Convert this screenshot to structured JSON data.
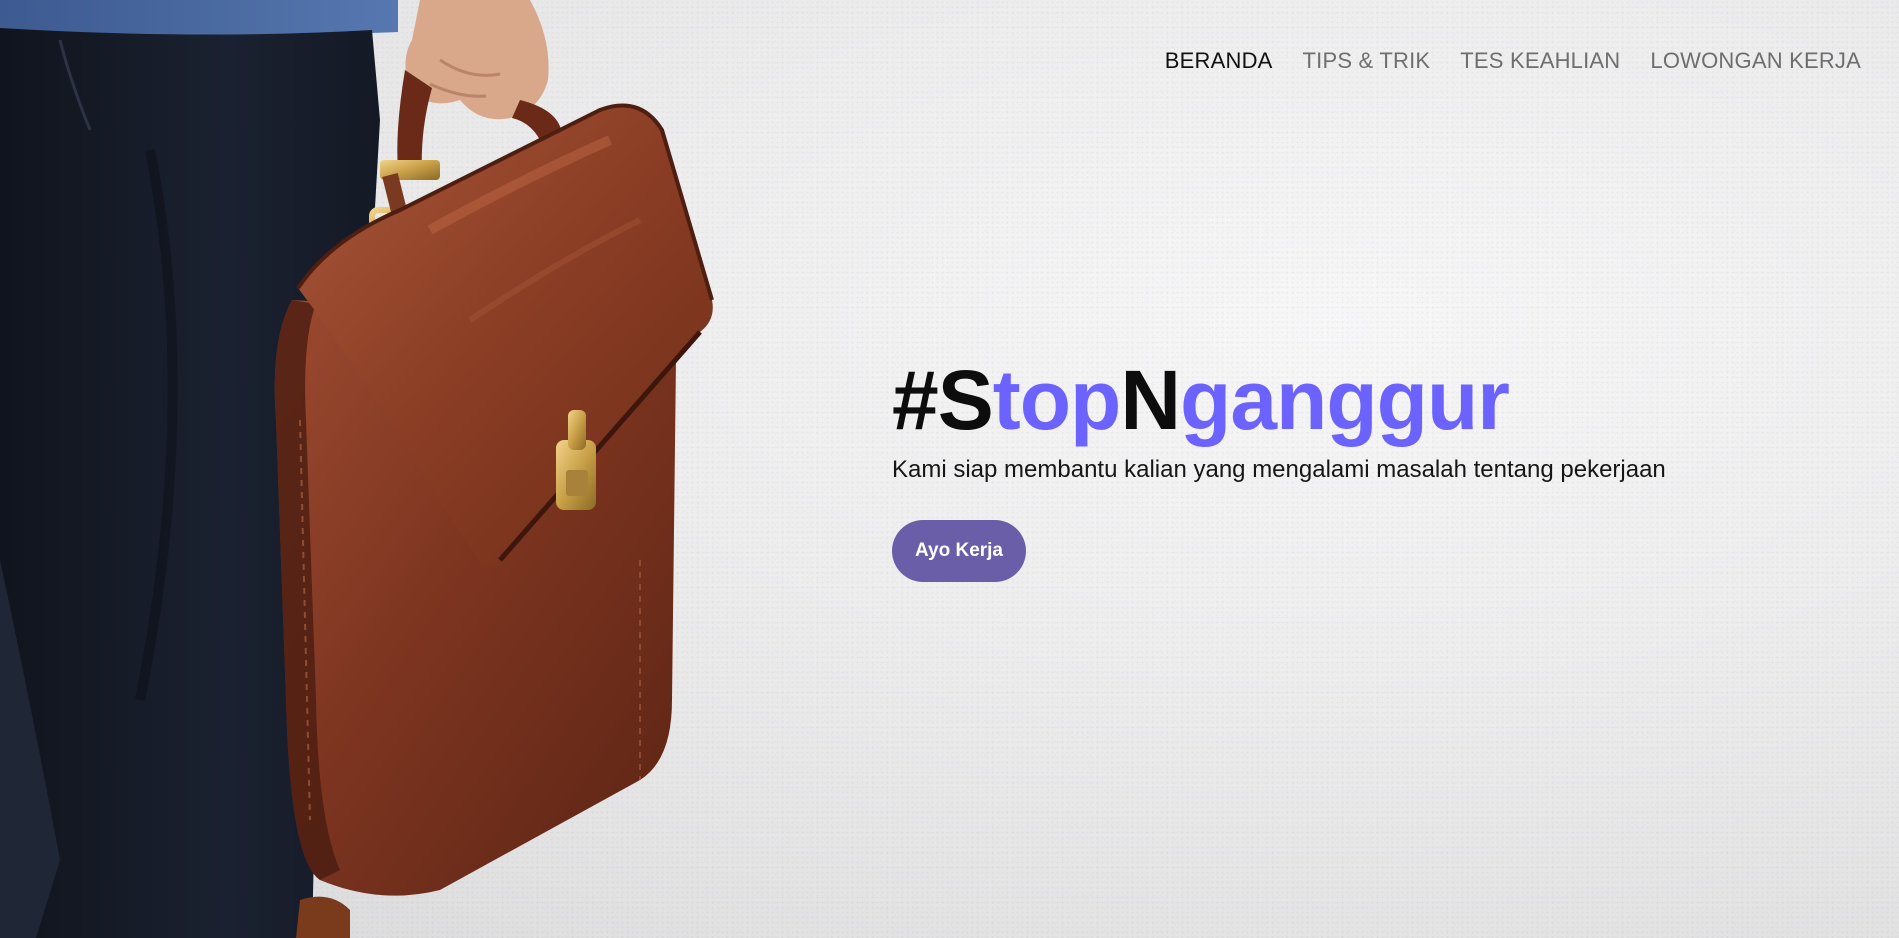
{
  "nav": {
    "items": [
      {
        "label": "BERANDA",
        "active": true
      },
      {
        "label": "TIPS & TRIK",
        "active": false
      },
      {
        "label": "TES KEAHLIAN",
        "active": false
      },
      {
        "label": "LOWONGAN KERJA",
        "active": false
      }
    ]
  },
  "hero": {
    "headline_parts": [
      "#S",
      "top",
      "N",
      "ganggur"
    ],
    "subtitle": "Kami siap membantu kalian yang mengalami masalah tentang pekerjaan",
    "cta_label": "Ayo Kerja"
  },
  "colors": {
    "accent": "#6c63ff",
    "button": "#6a5ea8",
    "text_dark": "#0d0d0d",
    "nav_inactive": "#6e6e6e"
  }
}
